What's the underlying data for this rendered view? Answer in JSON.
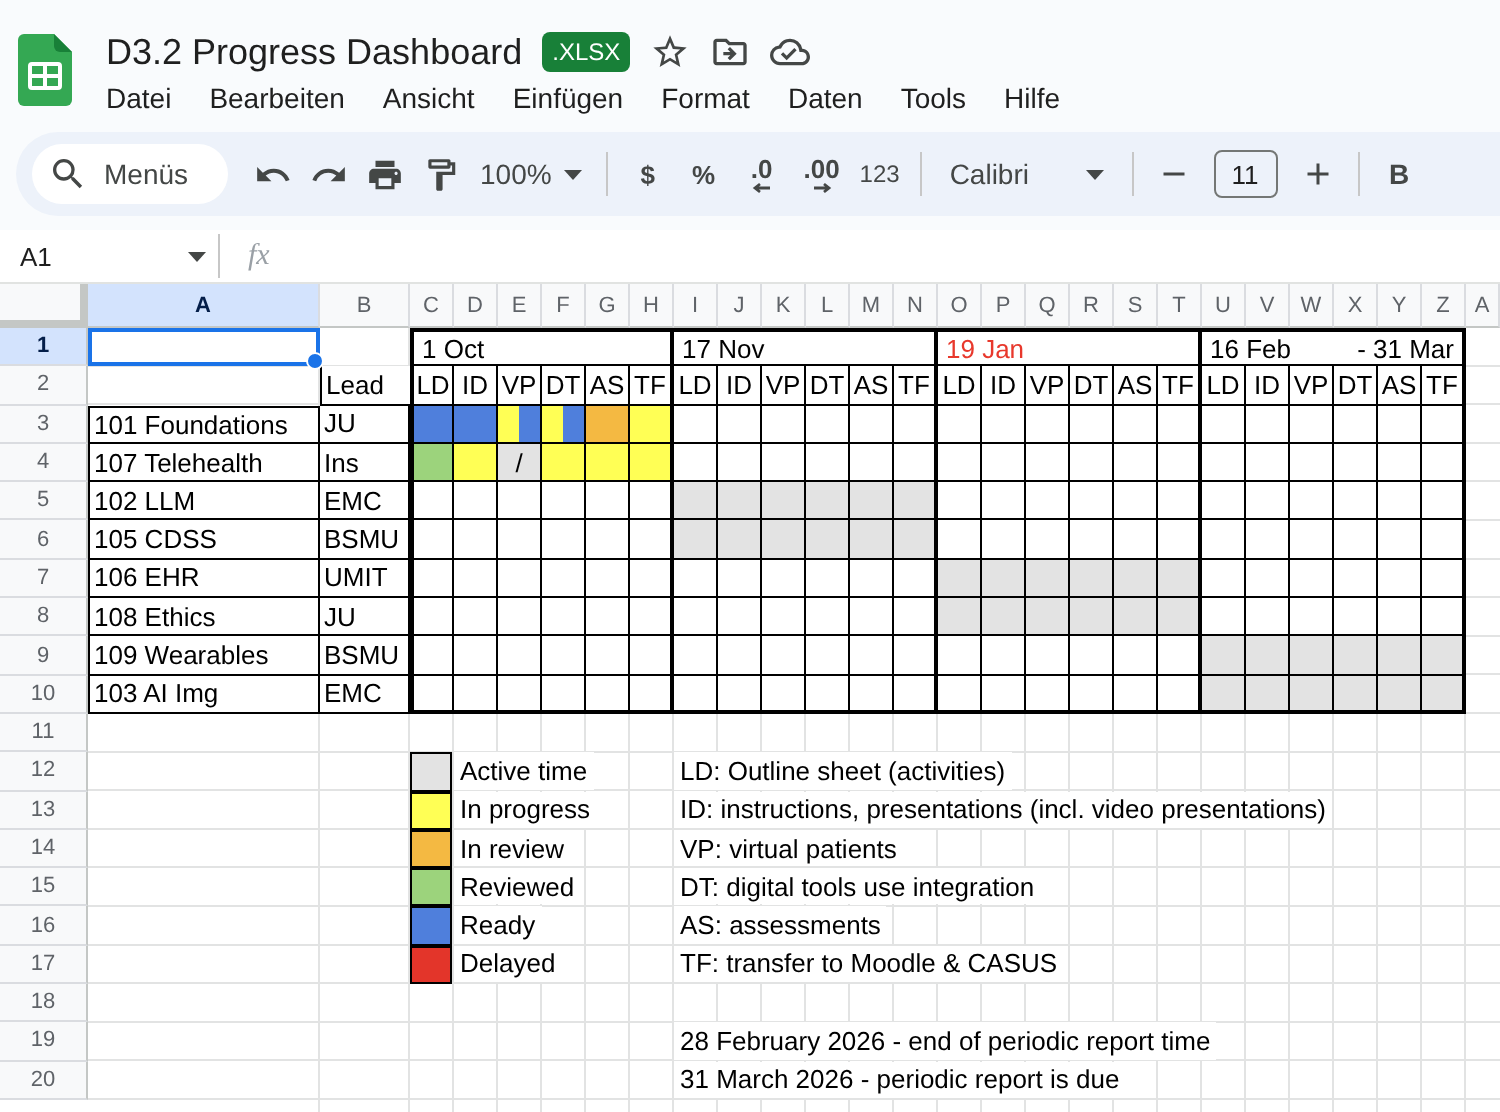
{
  "document": {
    "title": "D3.2 Progress Dashboard",
    "badge": ".XLSX"
  },
  "menu": [
    "Datei",
    "Bearbeiten",
    "Ansicht",
    "Einfügen",
    "Format",
    "Daten",
    "Tools",
    "Hilfe"
  ],
  "toolbar": {
    "search": {
      "placeholder": "Menüs"
    },
    "zoom": "100%",
    "currency": "$",
    "percent": "%",
    "decrease_decimals": ".0",
    "increase_decimals": ".00",
    "number_format": "123",
    "font": "Calibri",
    "font_size": "11",
    "bold": "B"
  },
  "formula_bar": {
    "name_box": "A1",
    "fx": "fx"
  },
  "columns": [
    {
      "label": "A",
      "selected": true
    },
    {
      "label": "B",
      "selected": false
    },
    {
      "label": "C",
      "selected": false
    },
    {
      "label": "D",
      "selected": false
    },
    {
      "label": "E",
      "selected": false
    },
    {
      "label": "F",
      "selected": false
    },
    {
      "label": "G",
      "selected": false
    },
    {
      "label": "H",
      "selected": false
    },
    {
      "label": "I",
      "selected": false
    },
    {
      "label": "J",
      "selected": false
    },
    {
      "label": "K",
      "selected": false
    },
    {
      "label": "L",
      "selected": false
    },
    {
      "label": "M",
      "selected": false
    },
    {
      "label": "N",
      "selected": false
    },
    {
      "label": "O",
      "selected": false
    },
    {
      "label": "P",
      "selected": false
    },
    {
      "label": "Q",
      "selected": false
    },
    {
      "label": "R",
      "selected": false
    },
    {
      "label": "S",
      "selected": false
    },
    {
      "label": "T",
      "selected": false
    },
    {
      "label": "U",
      "selected": false
    },
    {
      "label": "V",
      "selected": false
    },
    {
      "label": "W",
      "selected": false
    },
    {
      "label": "X",
      "selected": false
    },
    {
      "label": "Y",
      "selected": false
    },
    {
      "label": "Z",
      "selected": false
    },
    {
      "label": "A",
      "selected": false
    }
  ],
  "row_numbers": [
    {
      "label": "1",
      "selected": true
    },
    {
      "label": "2",
      "selected": false
    },
    {
      "label": "3",
      "selected": false
    },
    {
      "label": "4",
      "selected": false
    },
    {
      "label": "5",
      "selected": false
    },
    {
      "label": "6",
      "selected": false
    },
    {
      "label": "7",
      "selected": false
    },
    {
      "label": "8",
      "selected": false
    },
    {
      "label": "9",
      "selected": false
    },
    {
      "label": "10",
      "selected": false
    },
    {
      "label": "11",
      "selected": false
    },
    {
      "label": "12",
      "selected": false
    },
    {
      "label": "13",
      "selected": false
    },
    {
      "label": "14",
      "selected": false
    },
    {
      "label": "15",
      "selected": false
    },
    {
      "label": "16",
      "selected": false
    },
    {
      "label": "17",
      "selected": false
    },
    {
      "label": "18",
      "selected": false
    },
    {
      "label": "19",
      "selected": false
    },
    {
      "label": "20",
      "selected": false
    }
  ],
  "lead_header": "Lead",
  "periods": [
    {
      "label": "1 Oct",
      "color": "#000000",
      "activities": [
        "LD",
        "ID",
        "VP",
        "DT",
        "AS",
        "TF"
      ]
    },
    {
      "label": "17 Nov",
      "color": "#000000",
      "activities": [
        "LD",
        "ID",
        "VP",
        "DT",
        "AS",
        "TF"
      ]
    },
    {
      "label": "19 Jan",
      "color": "#e8382c",
      "activities": [
        "LD",
        "ID",
        "VP",
        "DT",
        "AS",
        "TF"
      ]
    },
    {
      "label": "16 Feb",
      "end": "- 31 Mar",
      "color": "#000000",
      "activities": [
        "LD",
        "ID",
        "VP",
        "DT",
        "AS",
        "TF"
      ]
    }
  ],
  "modules": [
    {
      "name": "101 Foundations",
      "lead": "JU",
      "cells": [
        {
          "kind": "ready"
        },
        {
          "kind": "ready"
        },
        {
          "kind": "split",
          "parts": [
            {
              "kind": "in_progress"
            },
            {
              "kind": "ready"
            }
          ]
        },
        {
          "kind": "split",
          "parts": [
            {
              "kind": "in_progress"
            },
            {
              "kind": "ready"
            }
          ]
        },
        {
          "kind": "review"
        },
        {
          "kind": "in_progress"
        },
        {
          "kind": "empty"
        },
        {
          "kind": "empty"
        },
        {
          "kind": "empty"
        },
        {
          "kind": "empty"
        },
        {
          "kind": "empty"
        },
        {
          "kind": "empty"
        },
        {
          "kind": "empty"
        },
        {
          "kind": "empty"
        },
        {
          "kind": "empty"
        },
        {
          "kind": "empty"
        },
        {
          "kind": "empty"
        },
        {
          "kind": "empty"
        },
        {
          "kind": "empty"
        },
        {
          "kind": "empty"
        },
        {
          "kind": "empty"
        },
        {
          "kind": "empty"
        },
        {
          "kind": "empty"
        },
        {
          "kind": "empty"
        }
      ]
    },
    {
      "name": "107 Telehealth",
      "lead": "Ins",
      "cells": [
        {
          "kind": "reviewed"
        },
        {
          "kind": "in_progress"
        },
        {
          "kind": "active",
          "text": "/"
        },
        {
          "kind": "in_progress"
        },
        {
          "kind": "in_progress"
        },
        {
          "kind": "in_progress"
        },
        {
          "kind": "empty"
        },
        {
          "kind": "empty"
        },
        {
          "kind": "empty"
        },
        {
          "kind": "empty"
        },
        {
          "kind": "empty"
        },
        {
          "kind": "empty"
        },
        {
          "kind": "empty"
        },
        {
          "kind": "empty"
        },
        {
          "kind": "empty"
        },
        {
          "kind": "empty"
        },
        {
          "kind": "empty"
        },
        {
          "kind": "empty"
        },
        {
          "kind": "empty"
        },
        {
          "kind": "empty"
        },
        {
          "kind": "empty"
        },
        {
          "kind": "empty"
        },
        {
          "kind": "empty"
        },
        {
          "kind": "empty"
        }
      ]
    },
    {
      "name": "102 LLM",
      "lead": "EMC",
      "cells": [
        {
          "kind": "empty"
        },
        {
          "kind": "empty"
        },
        {
          "kind": "empty"
        },
        {
          "kind": "empty"
        },
        {
          "kind": "empty"
        },
        {
          "kind": "empty"
        },
        {
          "kind": "active"
        },
        {
          "kind": "active"
        },
        {
          "kind": "active"
        },
        {
          "kind": "active"
        },
        {
          "kind": "active"
        },
        {
          "kind": "active"
        },
        {
          "kind": "empty"
        },
        {
          "kind": "empty"
        },
        {
          "kind": "empty"
        },
        {
          "kind": "empty"
        },
        {
          "kind": "empty"
        },
        {
          "kind": "empty"
        },
        {
          "kind": "empty"
        },
        {
          "kind": "empty"
        },
        {
          "kind": "empty"
        },
        {
          "kind": "empty"
        },
        {
          "kind": "empty"
        },
        {
          "kind": "empty"
        }
      ]
    },
    {
      "name": "105 CDSS",
      "lead": "BSMU",
      "cells": [
        {
          "kind": "empty"
        },
        {
          "kind": "empty"
        },
        {
          "kind": "empty"
        },
        {
          "kind": "empty"
        },
        {
          "kind": "empty"
        },
        {
          "kind": "empty"
        },
        {
          "kind": "active"
        },
        {
          "kind": "active"
        },
        {
          "kind": "active"
        },
        {
          "kind": "active"
        },
        {
          "kind": "active"
        },
        {
          "kind": "active"
        },
        {
          "kind": "empty"
        },
        {
          "kind": "empty"
        },
        {
          "kind": "empty"
        },
        {
          "kind": "empty"
        },
        {
          "kind": "empty"
        },
        {
          "kind": "empty"
        },
        {
          "kind": "empty"
        },
        {
          "kind": "empty"
        },
        {
          "kind": "empty"
        },
        {
          "kind": "empty"
        },
        {
          "kind": "empty"
        },
        {
          "kind": "empty"
        }
      ]
    },
    {
      "name": "106 EHR",
      "lead": "UMIT",
      "cells": [
        {
          "kind": "empty"
        },
        {
          "kind": "empty"
        },
        {
          "kind": "empty"
        },
        {
          "kind": "empty"
        },
        {
          "kind": "empty"
        },
        {
          "kind": "empty"
        },
        {
          "kind": "empty"
        },
        {
          "kind": "empty"
        },
        {
          "kind": "empty"
        },
        {
          "kind": "empty"
        },
        {
          "kind": "empty"
        },
        {
          "kind": "empty"
        },
        {
          "kind": "active"
        },
        {
          "kind": "active"
        },
        {
          "kind": "active"
        },
        {
          "kind": "active"
        },
        {
          "kind": "active"
        },
        {
          "kind": "active"
        },
        {
          "kind": "empty"
        },
        {
          "kind": "empty"
        },
        {
          "kind": "empty"
        },
        {
          "kind": "empty"
        },
        {
          "kind": "empty"
        },
        {
          "kind": "empty"
        }
      ]
    },
    {
      "name": "108 Ethics",
      "lead": "JU",
      "cells": [
        {
          "kind": "empty"
        },
        {
          "kind": "empty"
        },
        {
          "kind": "empty"
        },
        {
          "kind": "empty"
        },
        {
          "kind": "empty"
        },
        {
          "kind": "empty"
        },
        {
          "kind": "empty"
        },
        {
          "kind": "empty"
        },
        {
          "kind": "empty"
        },
        {
          "kind": "empty"
        },
        {
          "kind": "empty"
        },
        {
          "kind": "empty"
        },
        {
          "kind": "active"
        },
        {
          "kind": "active"
        },
        {
          "kind": "active"
        },
        {
          "kind": "active"
        },
        {
          "kind": "active"
        },
        {
          "kind": "active"
        },
        {
          "kind": "empty"
        },
        {
          "kind": "empty"
        },
        {
          "kind": "empty"
        },
        {
          "kind": "empty"
        },
        {
          "kind": "empty"
        },
        {
          "kind": "empty"
        }
      ]
    },
    {
      "name": "109 Wearables",
      "lead": "BSMU",
      "cells": [
        {
          "kind": "empty"
        },
        {
          "kind": "empty"
        },
        {
          "kind": "empty"
        },
        {
          "kind": "empty"
        },
        {
          "kind": "empty"
        },
        {
          "kind": "empty"
        },
        {
          "kind": "empty"
        },
        {
          "kind": "empty"
        },
        {
          "kind": "empty"
        },
        {
          "kind": "empty"
        },
        {
          "kind": "empty"
        },
        {
          "kind": "empty"
        },
        {
          "kind": "empty"
        },
        {
          "kind": "empty"
        },
        {
          "kind": "empty"
        },
        {
          "kind": "empty"
        },
        {
          "kind": "empty"
        },
        {
          "kind": "empty"
        },
        {
          "kind": "active"
        },
        {
          "kind": "active"
        },
        {
          "kind": "active"
        },
        {
          "kind": "active"
        },
        {
          "kind": "active"
        },
        {
          "kind": "active"
        }
      ]
    },
    {
      "name": "103 AI Img",
      "lead": "EMC",
      "cells": [
        {
          "kind": "empty"
        },
        {
          "kind": "empty"
        },
        {
          "kind": "empty"
        },
        {
          "kind": "empty"
        },
        {
          "kind": "empty"
        },
        {
          "kind": "empty"
        },
        {
          "kind": "empty"
        },
        {
          "kind": "empty"
        },
        {
          "kind": "empty"
        },
        {
          "kind": "empty"
        },
        {
          "kind": "empty"
        },
        {
          "kind": "empty"
        },
        {
          "kind": "empty"
        },
        {
          "kind": "empty"
        },
        {
          "kind": "empty"
        },
        {
          "kind": "empty"
        },
        {
          "kind": "empty"
        },
        {
          "kind": "empty"
        },
        {
          "kind": "active"
        },
        {
          "kind": "active"
        },
        {
          "kind": "active"
        },
        {
          "kind": "active"
        },
        {
          "kind": "active"
        },
        {
          "kind": "active"
        }
      ]
    }
  ],
  "legend": [
    {
      "kind": "active",
      "label": "Active time",
      "color": "#e3e3e3"
    },
    {
      "kind": "in_progress",
      "label": "In progress",
      "color": "#ffff55"
    },
    {
      "kind": "review",
      "label": "In review",
      "color": "#f4b942"
    },
    {
      "kind": "reviewed",
      "label": "Reviewed",
      "color": "#9cd37c"
    },
    {
      "kind": "ready",
      "label": "Ready",
      "color": "#4f7fdc"
    },
    {
      "kind": "delayed",
      "label": "Delayed",
      "color": "#e3352a"
    }
  ],
  "abbreviations": [
    "LD: Outline sheet (activities)",
    "ID: instructions, presentations (incl. video presentations)",
    "VP: virtual patients",
    "DT: digital tools use integration",
    "AS: assessments",
    "TF: transfer to Moodle & CASUS"
  ],
  "deadlines": [
    "28 February 2026 - end of periodic report time",
    "31 March 2026 - periodic report is due"
  ]
}
